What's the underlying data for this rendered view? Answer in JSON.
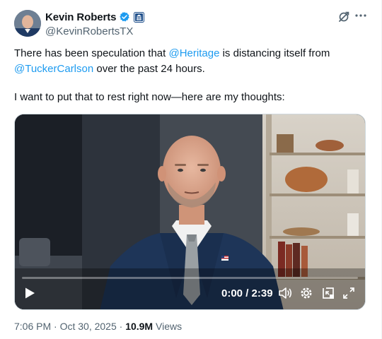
{
  "author": {
    "name": "Kevin Roberts",
    "handle": "@KevinRobertsTX",
    "verified": true,
    "verified_color": "#1d9bf0",
    "affiliate_badge": "heritage-affiliate-icon"
  },
  "post": {
    "line1_pre": "There has been speculation that ",
    "mention1": "@Heritage",
    "line1_post": " is distancing itself from",
    "mention2": "@TuckerCarlson",
    "line2_post": " over the past 24 hours.",
    "paragraph2": "I want to put that to rest right now—here are my thoughts:",
    "mention_color": "#1d9bf0"
  },
  "video": {
    "time_display": "0:00 / 2:39",
    "progress": 0.0
  },
  "meta": {
    "timestamp": "7:06 PM · Oct 30, 2025 · ",
    "views_count": "10.9M",
    "views_label": " Views"
  },
  "icons": {
    "grok": "grok-icon",
    "more": "more-icon",
    "play": "play-icon",
    "volume": "volume-icon",
    "settings": "gear-icon",
    "pip": "picture-in-picture-icon",
    "fullscreen": "fullscreen-icon"
  }
}
